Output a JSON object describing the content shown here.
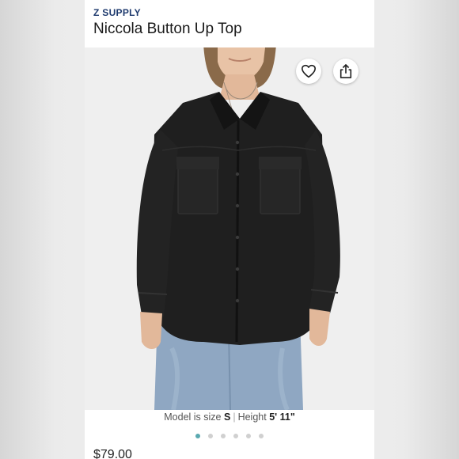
{
  "product": {
    "brand": "Z SUPPLY",
    "name": "Niccola Button Up Top",
    "price": "$79.00"
  },
  "model_info": {
    "prefix": "Model is size",
    "size": "S",
    "separator": "|",
    "height_label": "Height",
    "height": "5' 11\""
  },
  "actions": {
    "favorite_icon": "heart-outline-icon",
    "share_icon": "share-icon"
  },
  "carousel": {
    "total": 6,
    "active_index": 0
  },
  "colors": {
    "brand": "#1e3a6e",
    "active_dot": "#5aa9b0",
    "inactive_dot": "#d0d0d0"
  }
}
